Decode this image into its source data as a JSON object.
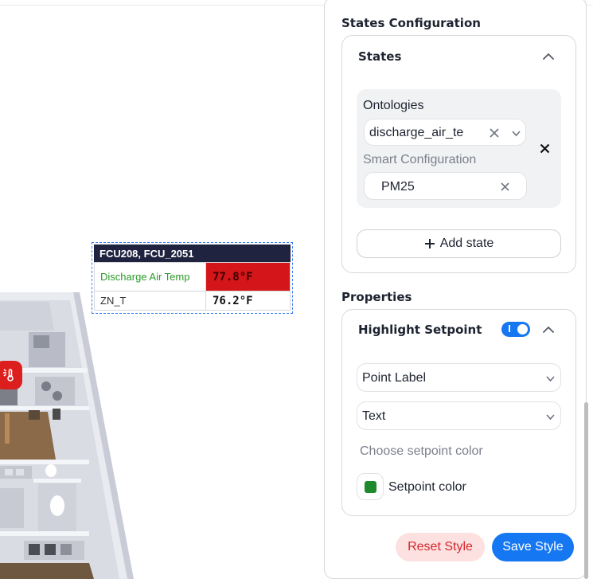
{
  "canvas": {
    "point_card": {
      "title": "FCU208, FCU_2051",
      "rows": [
        {
          "label": "Discharge Air Temp",
          "value": "77.8°F",
          "status": "alarm"
        },
        {
          "label": "ZN_T",
          "value": "76.2°F",
          "status": "normal"
        }
      ]
    },
    "badge_icon": "thermometer-sun-icon"
  },
  "panel": {
    "states_config_title": "States Configuration",
    "states_card": {
      "title": "States",
      "ontologies_label": "Ontologies",
      "ontology_value": "discharge_air_te",
      "smart_config_label": "Smart Configuration",
      "smart_config_value": "PM25",
      "add_state_label": "Add state"
    },
    "properties_title": "Properties",
    "properties_card": {
      "title": "Highlight Setpoint",
      "toggle_on": true,
      "select_1": "Point Label",
      "select_2": "Text",
      "choose_color_label": "Choose setpoint color",
      "setpoint_color_label": "Setpoint color",
      "setpoint_color": "#1e8a2c"
    },
    "reset_label": "Reset Style",
    "save_label": "Save Style"
  },
  "colors": {
    "accent": "#1677f2",
    "alarm": "#d4161a",
    "danger_text": "#d6262b",
    "header_dark": "#1f2340"
  }
}
